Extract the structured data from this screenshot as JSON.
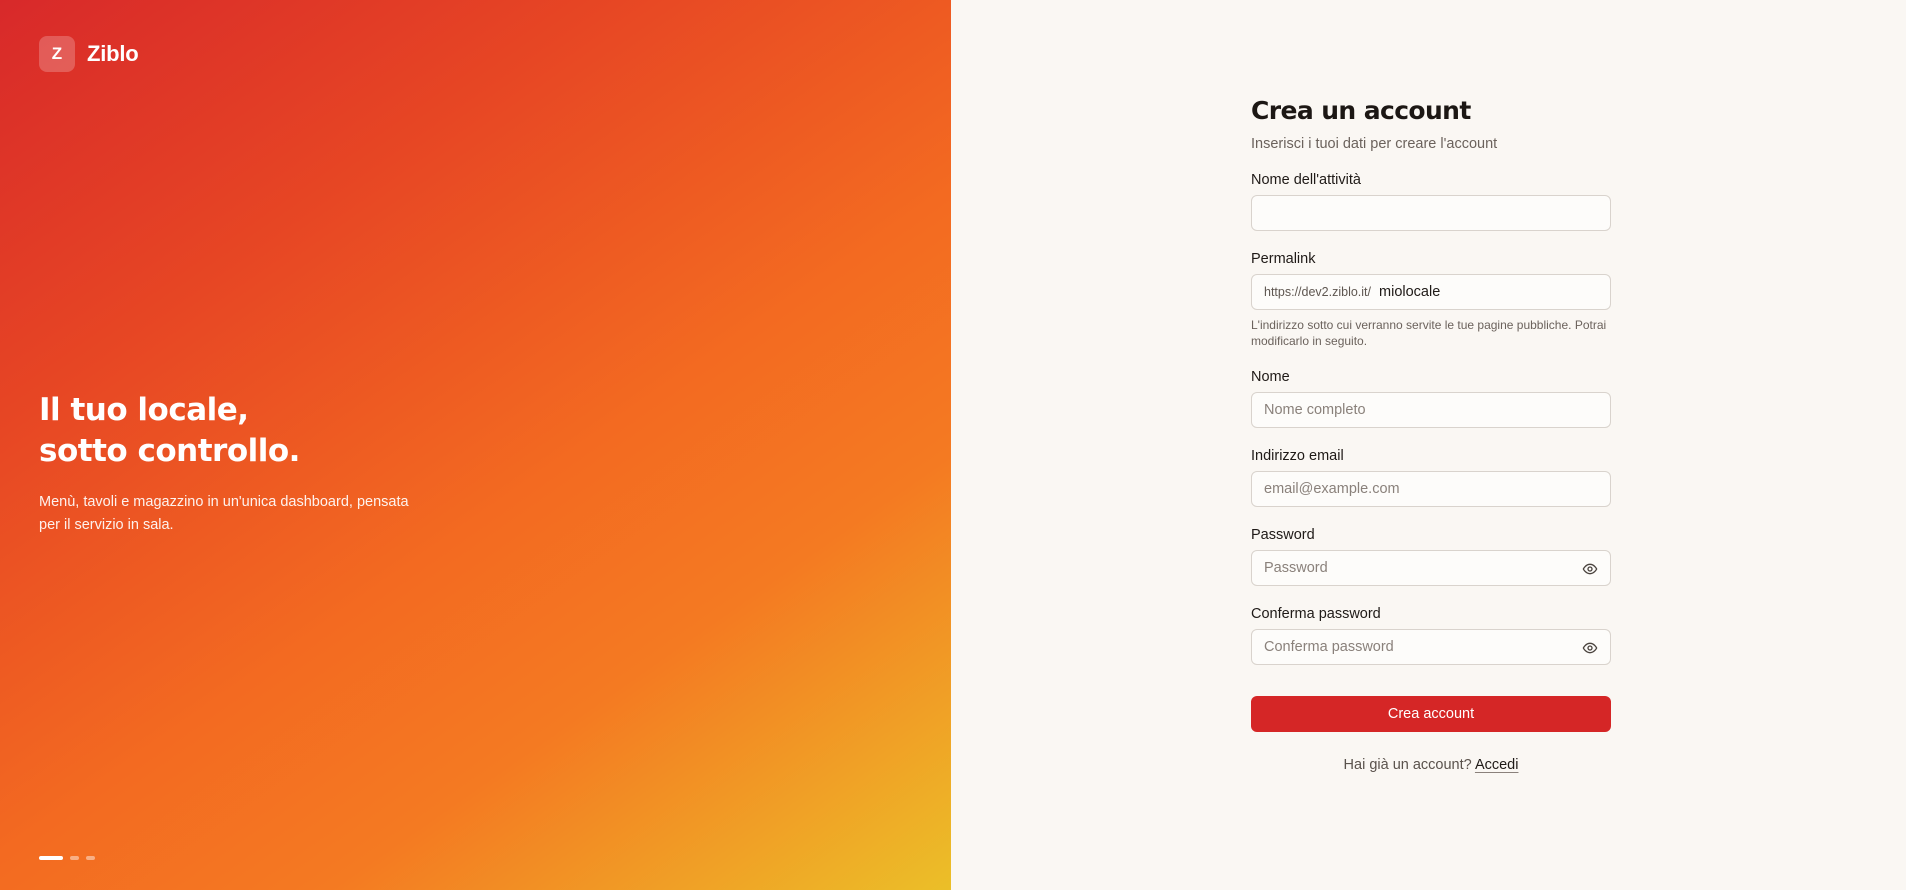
{
  "brand": {
    "mark": "Z",
    "name": "Ziblo"
  },
  "hero": {
    "title_line1": "Il tuo locale,",
    "title_line2": "sotto controllo.",
    "subtitle": "Menù, tavoli e magazzino in un'unica dashboard, pensata per il servizio in sala.",
    "slides": {
      "count": 3,
      "active_index": 0
    }
  },
  "form": {
    "title": "Crea un account",
    "subtitle": "Inserisci i tuoi dati per creare l'account",
    "business_name": {
      "label": "Nome dell'attività",
      "value": "",
      "placeholder": ""
    },
    "permalink": {
      "label": "Permalink",
      "prefix": "https://dev2.ziblo.it/",
      "value": "miolocale",
      "hint": "L'indirizzo sotto cui verranno servite le tue pagine pubbliche. Potrai modificarlo in seguito."
    },
    "name": {
      "label": "Nome",
      "value": "",
      "placeholder": "Nome completo"
    },
    "email": {
      "label": "Indirizzo email",
      "value": "",
      "placeholder": "email@example.com"
    },
    "password": {
      "label": "Password",
      "value": "",
      "placeholder": "Password",
      "toggle_icon": "eye-icon"
    },
    "confirm_password": {
      "label": "Conferma password",
      "value": "",
      "placeholder": "Conferma password",
      "toggle_icon": "eye-icon"
    },
    "submit_label": "Crea account",
    "signin_prompt": "Hai già un account?",
    "signin_link": "Accedi"
  },
  "colors": {
    "accent": "#d52626",
    "gradient_start": "#d8292a",
    "gradient_mid": "#f36a21",
    "gradient_end": "#ebbf28",
    "background": "#faf7f3"
  }
}
